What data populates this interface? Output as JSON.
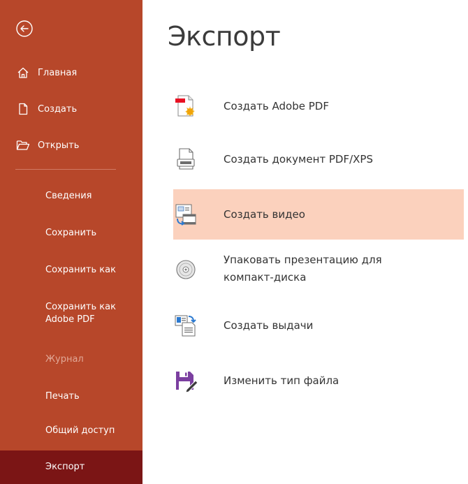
{
  "colors": {
    "sidebar": "#b7472a",
    "sidebar_active": "#7b1515",
    "selected_option": "#fbd1bd"
  },
  "sidebar": {
    "back_icon": "back-arrow-icon",
    "top_items": [
      {
        "label": "Главная",
        "icon": "home-icon"
      },
      {
        "label": "Создать",
        "icon": "new-file-icon"
      },
      {
        "label": "Открыть",
        "icon": "open-folder-icon"
      }
    ],
    "items": [
      {
        "label": "Сведения"
      },
      {
        "label": "Сохранить"
      },
      {
        "label": "Сохранить как"
      },
      {
        "label_line1": "Сохранить как",
        "label_line2": "Adobe PDF"
      },
      {
        "label": "Журнал"
      },
      {
        "label": "Печать"
      },
      {
        "label": "Общий доступ"
      },
      {
        "label": "Экспорт"
      }
    ]
  },
  "main": {
    "title": "Экспорт",
    "options": [
      {
        "label": "Создать Adobe PDF",
        "icon": "adobe-pdf-icon"
      },
      {
        "label": "Создать документ PDF/XPS",
        "icon": "pdf-xps-document-icon"
      },
      {
        "label": "Создать видео",
        "icon": "video-icon"
      },
      {
        "label_line1": "Упаковать презентацию для",
        "label_line2": "компакт-диска",
        "icon": "cd-icon"
      },
      {
        "label": "Создать выдачи",
        "icon": "handouts-icon"
      },
      {
        "label": "Изменить тип файла",
        "icon": "change-file-type-icon"
      }
    ]
  }
}
